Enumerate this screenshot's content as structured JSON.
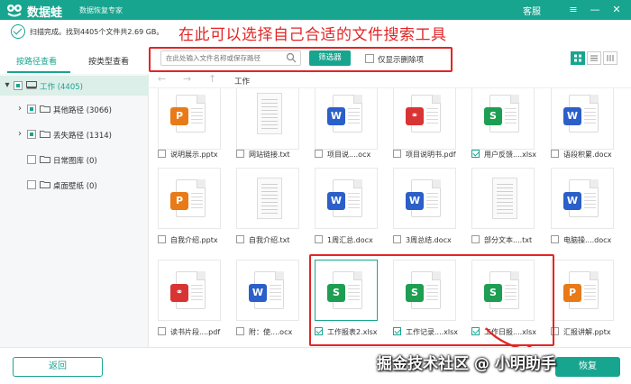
{
  "app": {
    "name": "数据蛙",
    "subtitle": "数据恢复专家",
    "service_label": "客服"
  },
  "status": {
    "text": "扫描完成。找到4405个文件共2.69 GB。"
  },
  "annotation": {
    "top_text": "在此可以选择自己合适的文件搜索工具"
  },
  "left_tabs": {
    "by_path": "按路径查看",
    "by_type": "按类型查看"
  },
  "tree": [
    {
      "label": "工作 (4405)"
    },
    {
      "label": "其他路径 (3066)"
    },
    {
      "label": "丢失路径 (1314)"
    },
    {
      "label": "日常图库 (0)"
    },
    {
      "label": "桌面壁纸 (0)"
    }
  ],
  "toolbar": {
    "search_placeholder": "在此处输入文件名称或保存路径",
    "filter_label": "筛选器",
    "deleted_only_label": "仅显示删除项"
  },
  "nav": {
    "breadcrumb": "工作"
  },
  "files": [
    {
      "type": "pptx",
      "badge": "P",
      "name": "说明展示.pptx",
      "checked": false
    },
    {
      "type": "txt",
      "badge": "",
      "name": "网站链接.txt",
      "checked": false
    },
    {
      "type": "docx",
      "badge": "W",
      "name": "项目说....ocx",
      "checked": false
    },
    {
      "type": "pdf",
      "badge": "pdf",
      "name": "项目说明书.pdf",
      "checked": false
    },
    {
      "type": "xlsx",
      "badge": "S",
      "name": "用户反馈....xlsx",
      "checked": true
    },
    {
      "type": "docx",
      "badge": "W",
      "name": "语段积累.docx",
      "checked": false
    },
    {
      "type": "pptx",
      "badge": "P",
      "name": "自我介绍.pptx",
      "checked": false
    },
    {
      "type": "txt",
      "badge": "",
      "name": "自我介绍.txt",
      "checked": false
    },
    {
      "type": "docx",
      "badge": "W",
      "name": "1周汇总.docx",
      "checked": false
    },
    {
      "type": "docx",
      "badge": "W",
      "name": "3周总结.docx",
      "checked": false
    },
    {
      "type": "txt",
      "badge": "",
      "name": "部分文本....txt",
      "checked": false
    },
    {
      "type": "docx",
      "badge": "W",
      "name": "电脑操....docx",
      "checked": false
    },
    {
      "type": "pdf",
      "badge": "pdf",
      "name": "读书片段....pdf",
      "checked": false
    },
    {
      "type": "docx",
      "badge": "W",
      "name": "附：使....ocx",
      "checked": false
    },
    {
      "type": "xlsx",
      "badge": "S",
      "name": "工作报表2.xlsx",
      "checked": true
    },
    {
      "type": "xlsx",
      "badge": "S",
      "name": "工作记录....xlsx",
      "checked": true
    },
    {
      "type": "xlsx",
      "badge": "S",
      "name": "工作日报....xlsx",
      "checked": true
    },
    {
      "type": "pptx",
      "badge": "P",
      "name": "汇报讲解.pptx",
      "checked": false
    }
  ],
  "footer": {
    "back_label": "返回",
    "recover_label": "恢复"
  },
  "watermark": {
    "text": "掘金技术社区 @ 小明助手"
  },
  "colors": {
    "accent": "#18a58f",
    "annotation_red": "#e22525",
    "word_blue": "#2b5fc9",
    "excel_green": "#1e9e52",
    "ppt_orange": "#e87a17",
    "pdf_red": "#d93434"
  }
}
